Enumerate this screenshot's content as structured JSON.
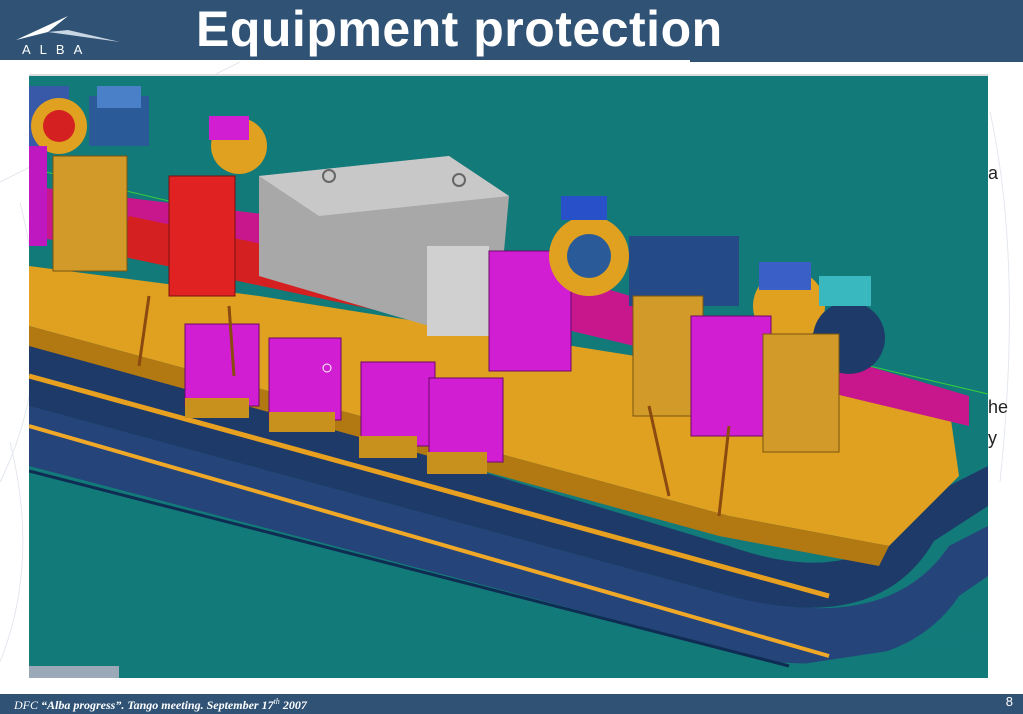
{
  "slide": {
    "title": "Equipment protection",
    "logo_text": "ALBA",
    "page_number": "8",
    "side_fragments": [
      "a",
      "he",
      "y"
    ]
  },
  "footer": {
    "author": "DFC",
    "event": "“Alba progress”. Tango meeting.",
    "date_prefix": "September 17",
    "date_suffix": "th",
    "year": "2007"
  },
  "figure": {
    "description_icon": "cad-accelerator-render",
    "colors": {
      "background": "#137a7a",
      "magenta": "#d21ed2",
      "orange": "#e0a020",
      "navy": "#1e3a68",
      "grey": "#a8a8a8",
      "red": "#d42020"
    }
  }
}
